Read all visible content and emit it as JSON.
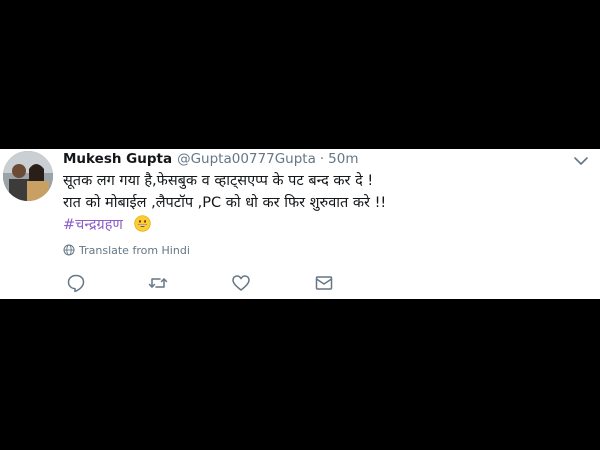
{
  "tweet": {
    "display_name": "Mukesh Gupta",
    "handle": "@Gupta00777Gupta",
    "separator": "·",
    "time": "50m",
    "lines": [
      "सूतक लग गया है,फेसबुक व व्हाट्सएप्प के पट बन्द कर दे !",
      "रात को मोबाईल ,लैपटॉप ,PC को धो कर फिर शुरुवात करे !!"
    ],
    "hashtag": "#चन्द्रग्रहण",
    "translate_label": "Translate from Hindi"
  },
  "icons": {
    "caret": "chevron-down-icon",
    "reply": "reply-icon",
    "retweet": "retweet-icon",
    "like": "heart-icon",
    "dm": "envelope-icon",
    "translate": "globe-icon",
    "emoji": "grinning-face-emoji"
  },
  "colors": {
    "background": "#000000",
    "card": "#ffffff",
    "text": "#14171a",
    "secondary": "#657786",
    "hashtag": "#8e5fc8",
    "emoji": "#ffcc33"
  }
}
